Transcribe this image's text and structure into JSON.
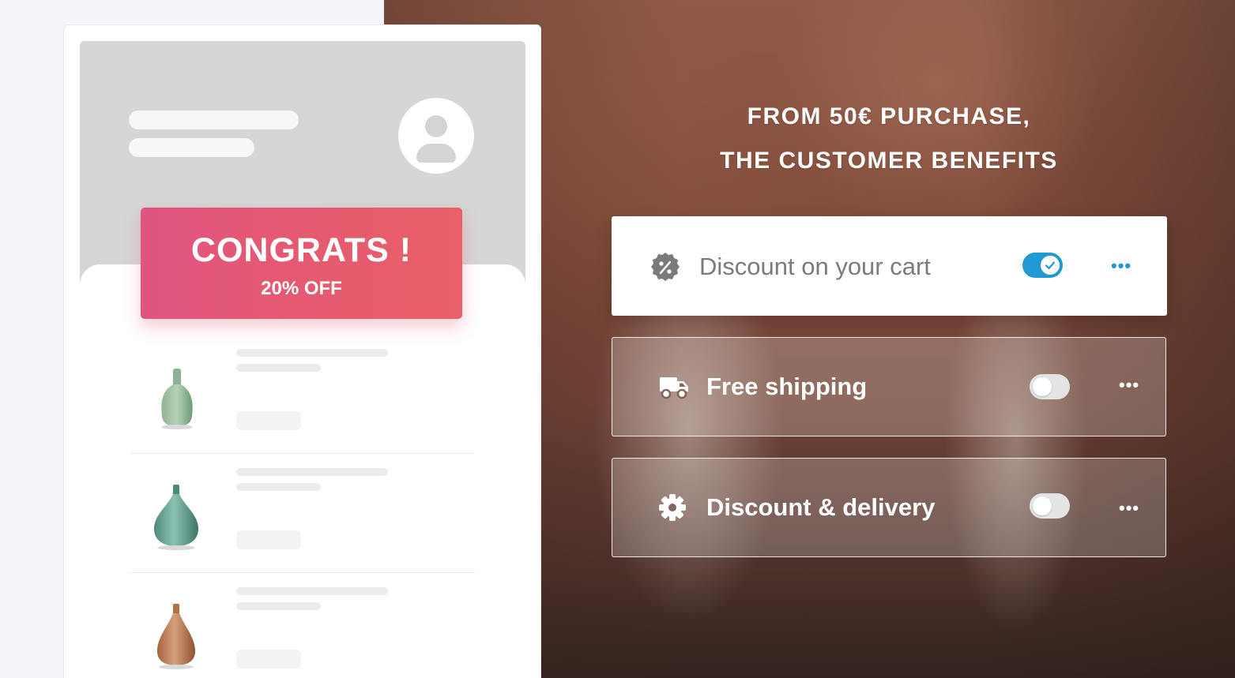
{
  "promo_mockup": {
    "banner_title": "CONGRATS !",
    "banner_subtitle": "20% OFF"
  },
  "offer": {
    "headline_line1": "FROM 50€ PURCHASE,",
    "headline_line2": "THE CUSTOMER BENEFITS"
  },
  "benefits": [
    {
      "label": "Discount on your cart",
      "icon": "discount-badge-icon",
      "enabled": true
    },
    {
      "label": "Free shipping",
      "icon": "truck-icon",
      "enabled": false
    },
    {
      "label": "Discount & delivery",
      "icon": "gear-icon",
      "enabled": false
    }
  ],
  "more_options_glyph": "•••",
  "colors": {
    "banner": "#e65b6d",
    "toggle_on": "#2199d2",
    "active_card_text": "#7b7b7b"
  }
}
